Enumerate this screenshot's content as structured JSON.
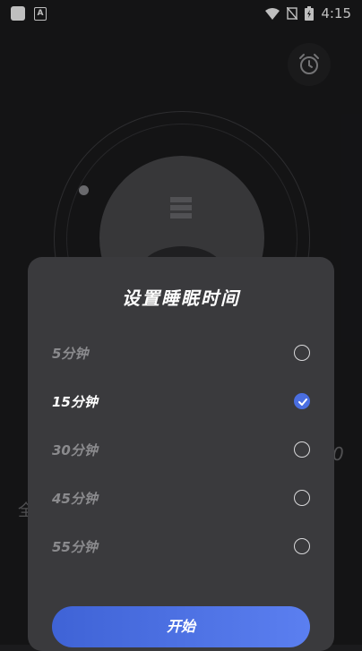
{
  "status_bar": {
    "time": "4:15"
  },
  "sheet": {
    "title": "设置睡眠时间",
    "options": [
      {
        "label": "5分钟",
        "selected": false
      },
      {
        "label": "15分钟",
        "selected": true
      },
      {
        "label": "30分钟",
        "selected": false
      },
      {
        "label": "45分钟",
        "selected": false
      },
      {
        "label": "55分钟",
        "selected": false
      }
    ],
    "start_label": "开始"
  },
  "background": {
    "digit": "0",
    "char": "全"
  },
  "colors": {
    "accent": "#4a6ee0",
    "sheet_bg": "#3a3a3d",
    "page_bg": "#1b1b1d"
  }
}
